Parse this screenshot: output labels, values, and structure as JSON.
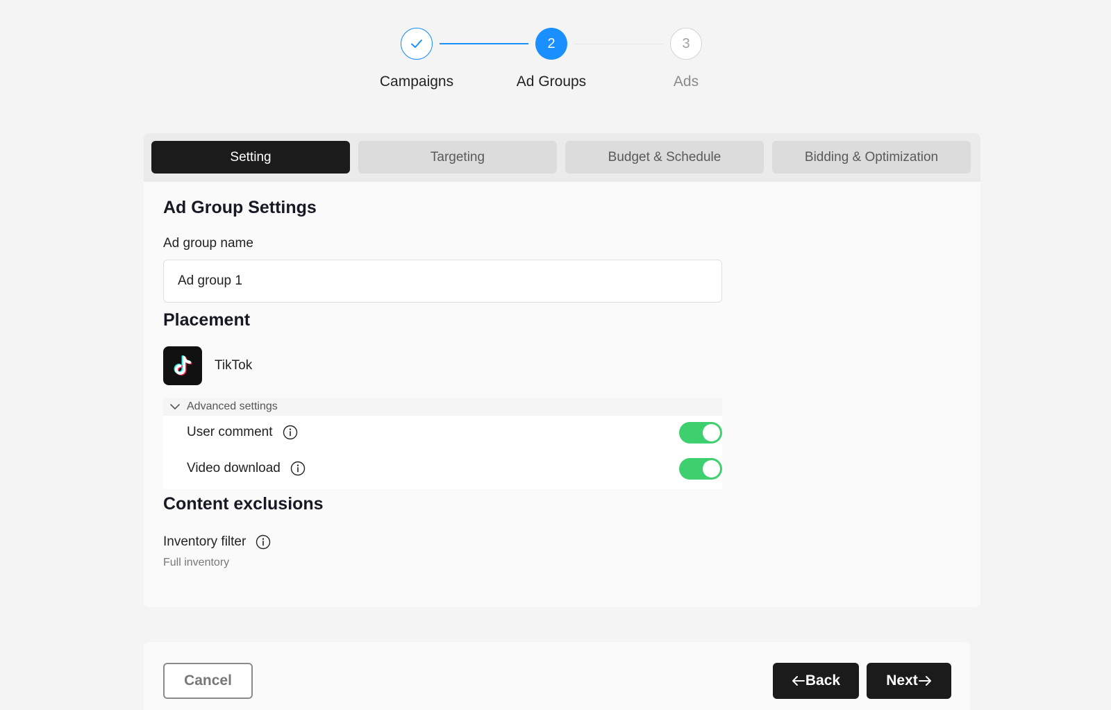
{
  "stepper": {
    "steps": [
      {
        "label": "Campaigns",
        "number": "",
        "state": "done",
        "icon": "check-icon"
      },
      {
        "label": "Ad Groups",
        "number": "2",
        "state": "active"
      },
      {
        "label": "Ads",
        "number": "3",
        "state": "pending"
      }
    ]
  },
  "tabs": [
    {
      "label": "Setting",
      "active": true
    },
    {
      "label": "Targeting",
      "active": false
    },
    {
      "label": "Budget & Schedule",
      "active": false
    },
    {
      "label": "Bidding & Optimization",
      "active": false
    }
  ],
  "ad_group_settings": {
    "title": "Ad Group Settings",
    "name_label": "Ad group name",
    "name_value": "Ad group 1"
  },
  "placement": {
    "title": "Placement",
    "platform": "TikTok",
    "platform_icon": "tiktok-logo-icon",
    "advanced_label": "Advanced settings",
    "options": [
      {
        "label": "User comment",
        "enabled": true
      },
      {
        "label": "Video download",
        "enabled": true
      }
    ]
  },
  "content_exclusions": {
    "title": "Content exclusions",
    "inventory_label": "Inventory filter",
    "inventory_value": "Full inventory"
  },
  "footer": {
    "cancel_label": "Cancel",
    "back_label": "Back",
    "next_label": "Next"
  },
  "colors": {
    "accent_blue": "#1a8fff",
    "toggle_on": "#3ecf6e",
    "dark_button": "#1b1b1b"
  }
}
